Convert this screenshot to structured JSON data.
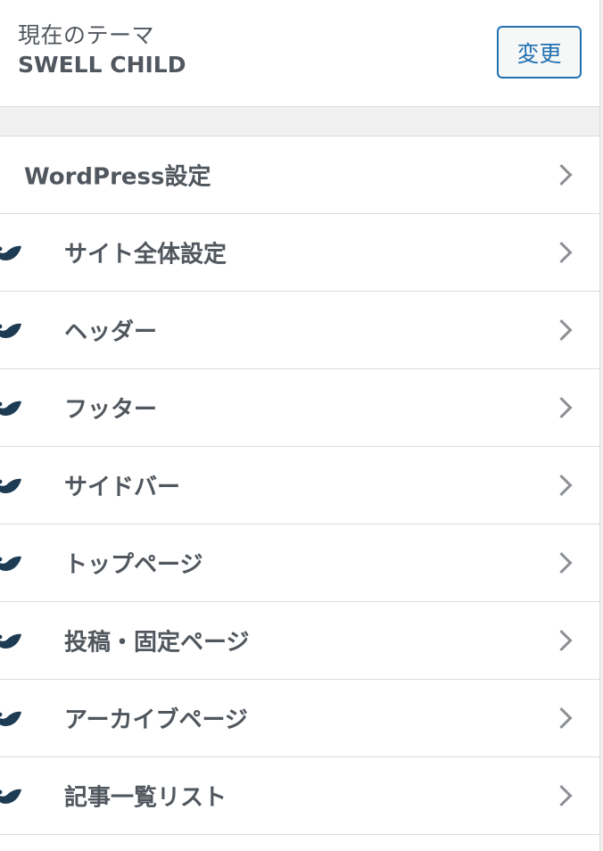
{
  "theme": {
    "label": "現在のテーマ",
    "name": "SWELL CHILD",
    "change_button": "変更"
  },
  "colors": {
    "accent": "#2271b1",
    "brand_icon": "#1d3b53",
    "text": "#50575e"
  },
  "menu": {
    "items": [
      {
        "label": "WordPress設定",
        "icon": null
      },
      {
        "label": "サイト全体設定",
        "icon": "swell-brand-icon"
      },
      {
        "label": "ヘッダー",
        "icon": "swell-brand-icon"
      },
      {
        "label": "フッター",
        "icon": "swell-brand-icon"
      },
      {
        "label": "サイドバー",
        "icon": "swell-brand-icon"
      },
      {
        "label": "トップページ",
        "icon": "swell-brand-icon"
      },
      {
        "label": "投稿・固定ページ",
        "icon": "swell-brand-icon"
      },
      {
        "label": "アーカイブページ",
        "icon": "swell-brand-icon"
      },
      {
        "label": "記事一覧リスト",
        "icon": "swell-brand-icon"
      }
    ]
  }
}
